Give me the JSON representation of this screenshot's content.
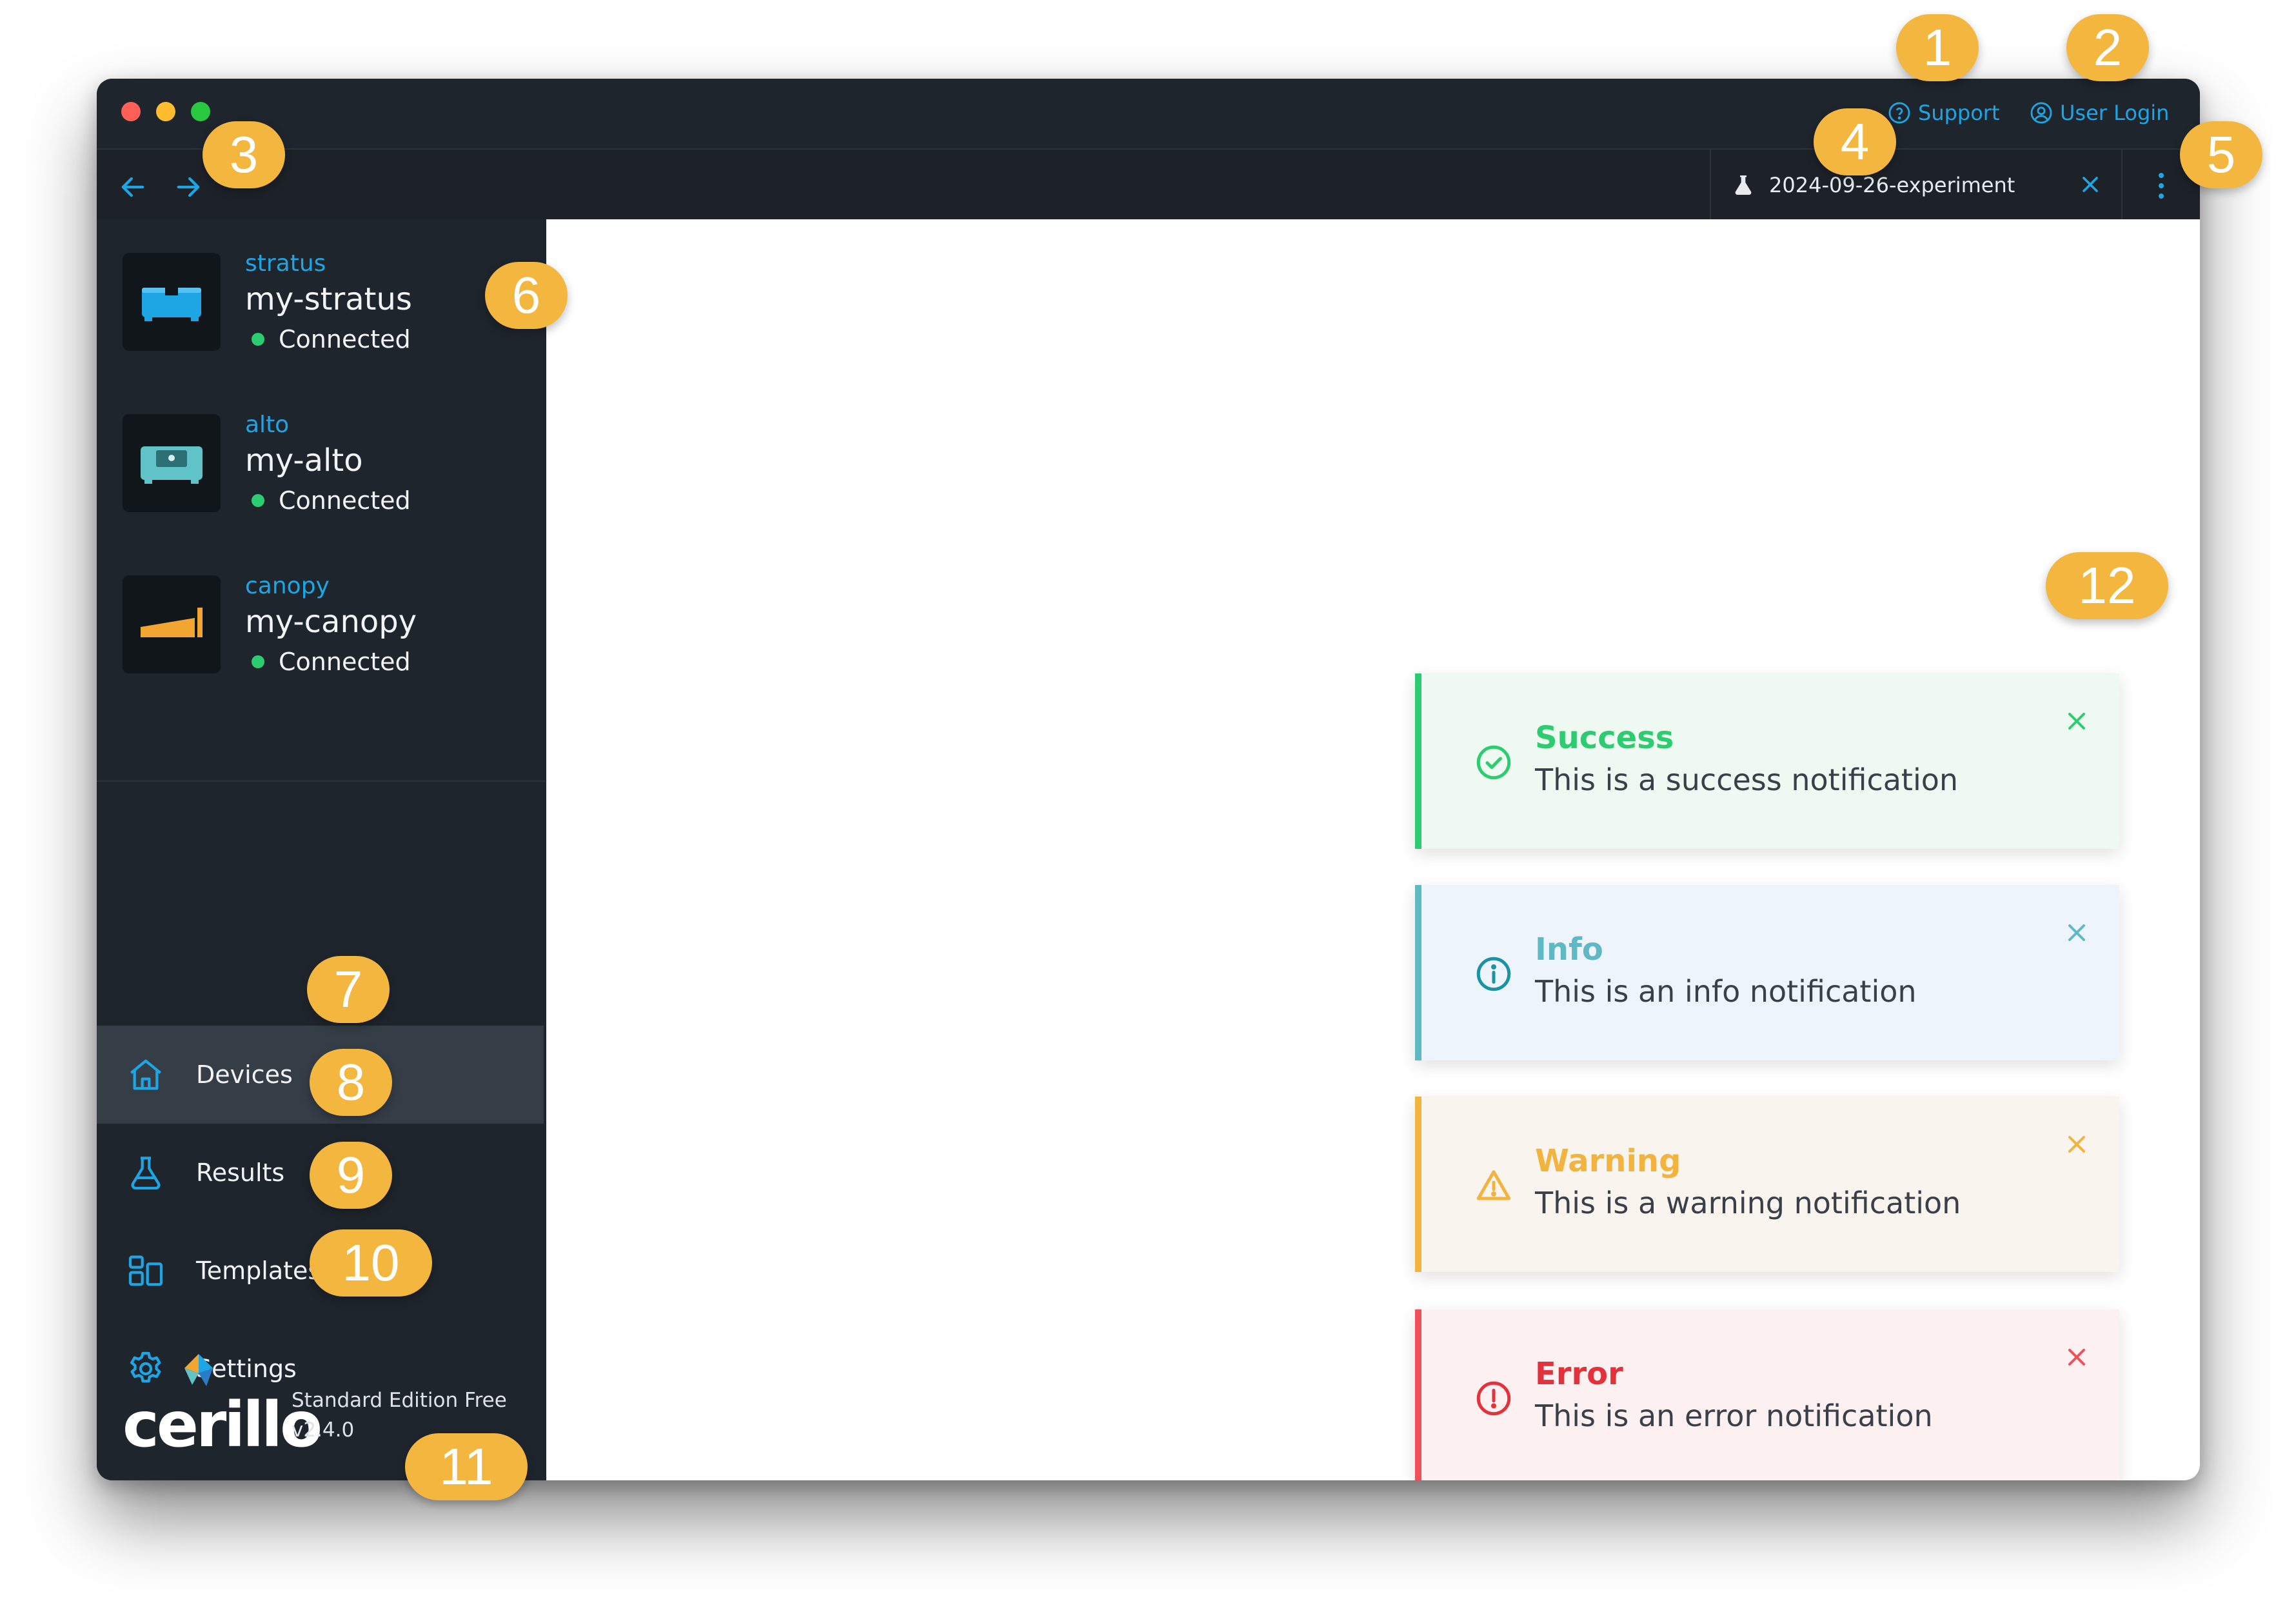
{
  "header": {
    "support_label": "Support",
    "user_login_label": "User Login",
    "active_tab": "2024-09-26-experiment"
  },
  "devices": [
    {
      "type": "stratus",
      "name": "my-stratus",
      "status": "Connected",
      "color": "#1ea5e4"
    },
    {
      "type": "alto",
      "name": "my-alto",
      "status": "Connected",
      "color": "#5fc3c8"
    },
    {
      "type": "canopy",
      "name": "my-canopy",
      "status": "Connected",
      "color": "#f2a531"
    }
  ],
  "nav": {
    "items": [
      {
        "label": "Devices",
        "icon": "home-icon",
        "active": true
      },
      {
        "label": "Results",
        "icon": "flask-icon"
      },
      {
        "label": "Templates",
        "icon": "template-icon"
      },
      {
        "label": "Settings",
        "icon": "gear-icon"
      }
    ]
  },
  "brand": {
    "wordmark": "cerillo",
    "edition": "Standard Edition Free",
    "version": "v2.4.0"
  },
  "notifications": [
    {
      "title": "Success",
      "message": "This is a success notification",
      "accent": "#2ecc71",
      "bg": "#eefaf1"
    },
    {
      "title": "Info",
      "message": "This is an info notification",
      "accent": "#5fb9c5",
      "bg": "#eef4fb"
    },
    {
      "title": "Warning",
      "message": "This is a warning notification",
      "accent": "#f2b33f",
      "bg": "#f9f5ee"
    },
    {
      "title": "Error",
      "message": "This is an error notification",
      "accent": "#f0505a",
      "bg": "#fdf0f0"
    }
  ],
  "callouts": [
    "1",
    "2",
    "3",
    "4",
    "5",
    "6",
    "7",
    "8",
    "9",
    "10",
    "11",
    "12"
  ],
  "colors": {
    "accent": "#1ea5e4",
    "callout": "#f3b63f"
  }
}
